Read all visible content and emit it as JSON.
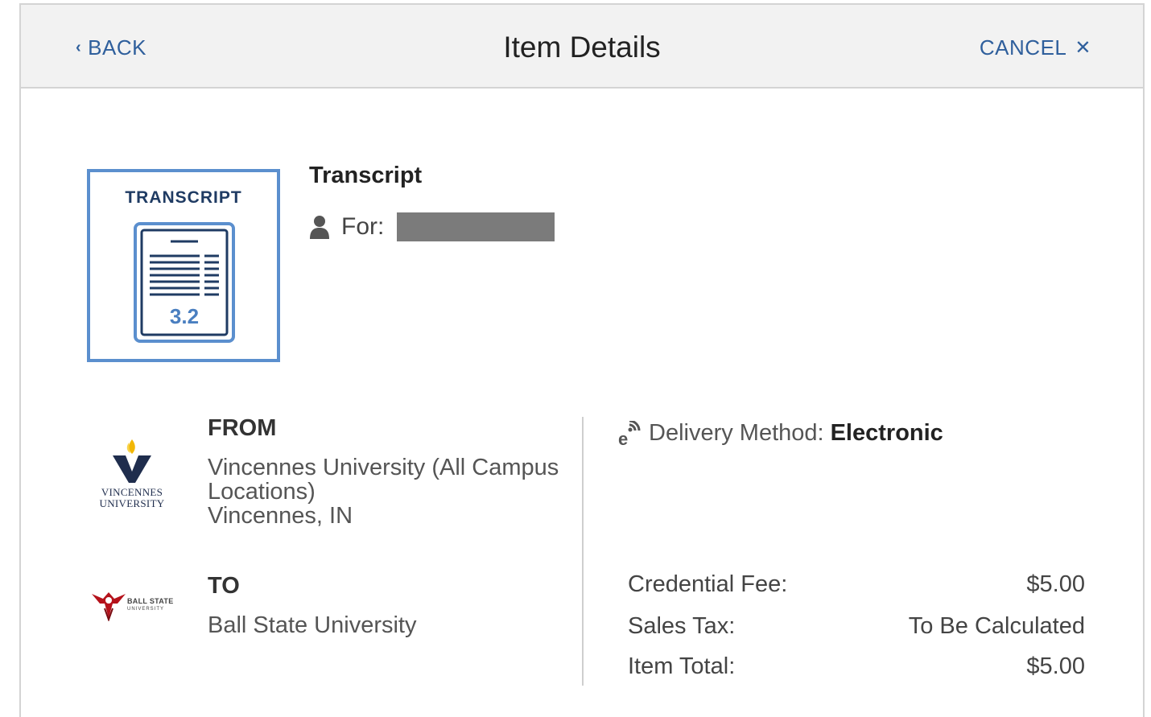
{
  "header": {
    "back_label": "BACK",
    "title": "Item Details",
    "cancel_label": "CANCEL"
  },
  "item": {
    "thumbnail_label": "TRANSCRIPT",
    "thumbnail_version": "3.2",
    "name": "Transcript",
    "for_label": "For:"
  },
  "from": {
    "heading": "FROM",
    "line1": "Vincennes University (All Campus",
    "line2": "Locations)",
    "line3": "Vincennes, IN",
    "logo_line1": "VINCENNES",
    "logo_line2": "UNIVERSITY"
  },
  "to": {
    "heading": "TO",
    "name": "Ball State University",
    "logo_line1": "BALL STATE",
    "logo_line2": "UNIVERSITY"
  },
  "delivery": {
    "label": "Delivery Method:",
    "value": "Electronic"
  },
  "fees": [
    {
      "label": "Credential Fee:",
      "value": "$5.00"
    },
    {
      "label": "Sales Tax:",
      "value": "To Be Calculated"
    },
    {
      "label": "Item Total:",
      "value": "$5.00"
    }
  ],
  "colors": {
    "accent": "#2f5f9c",
    "thumbnail_border": "#5b8fce",
    "header_bg": "#f2f2f2",
    "redaction": "#7b7b7b"
  },
  "icons": [
    "chevron-left-icon",
    "close-icon",
    "user-icon",
    "electronic-delivery-icon"
  ]
}
